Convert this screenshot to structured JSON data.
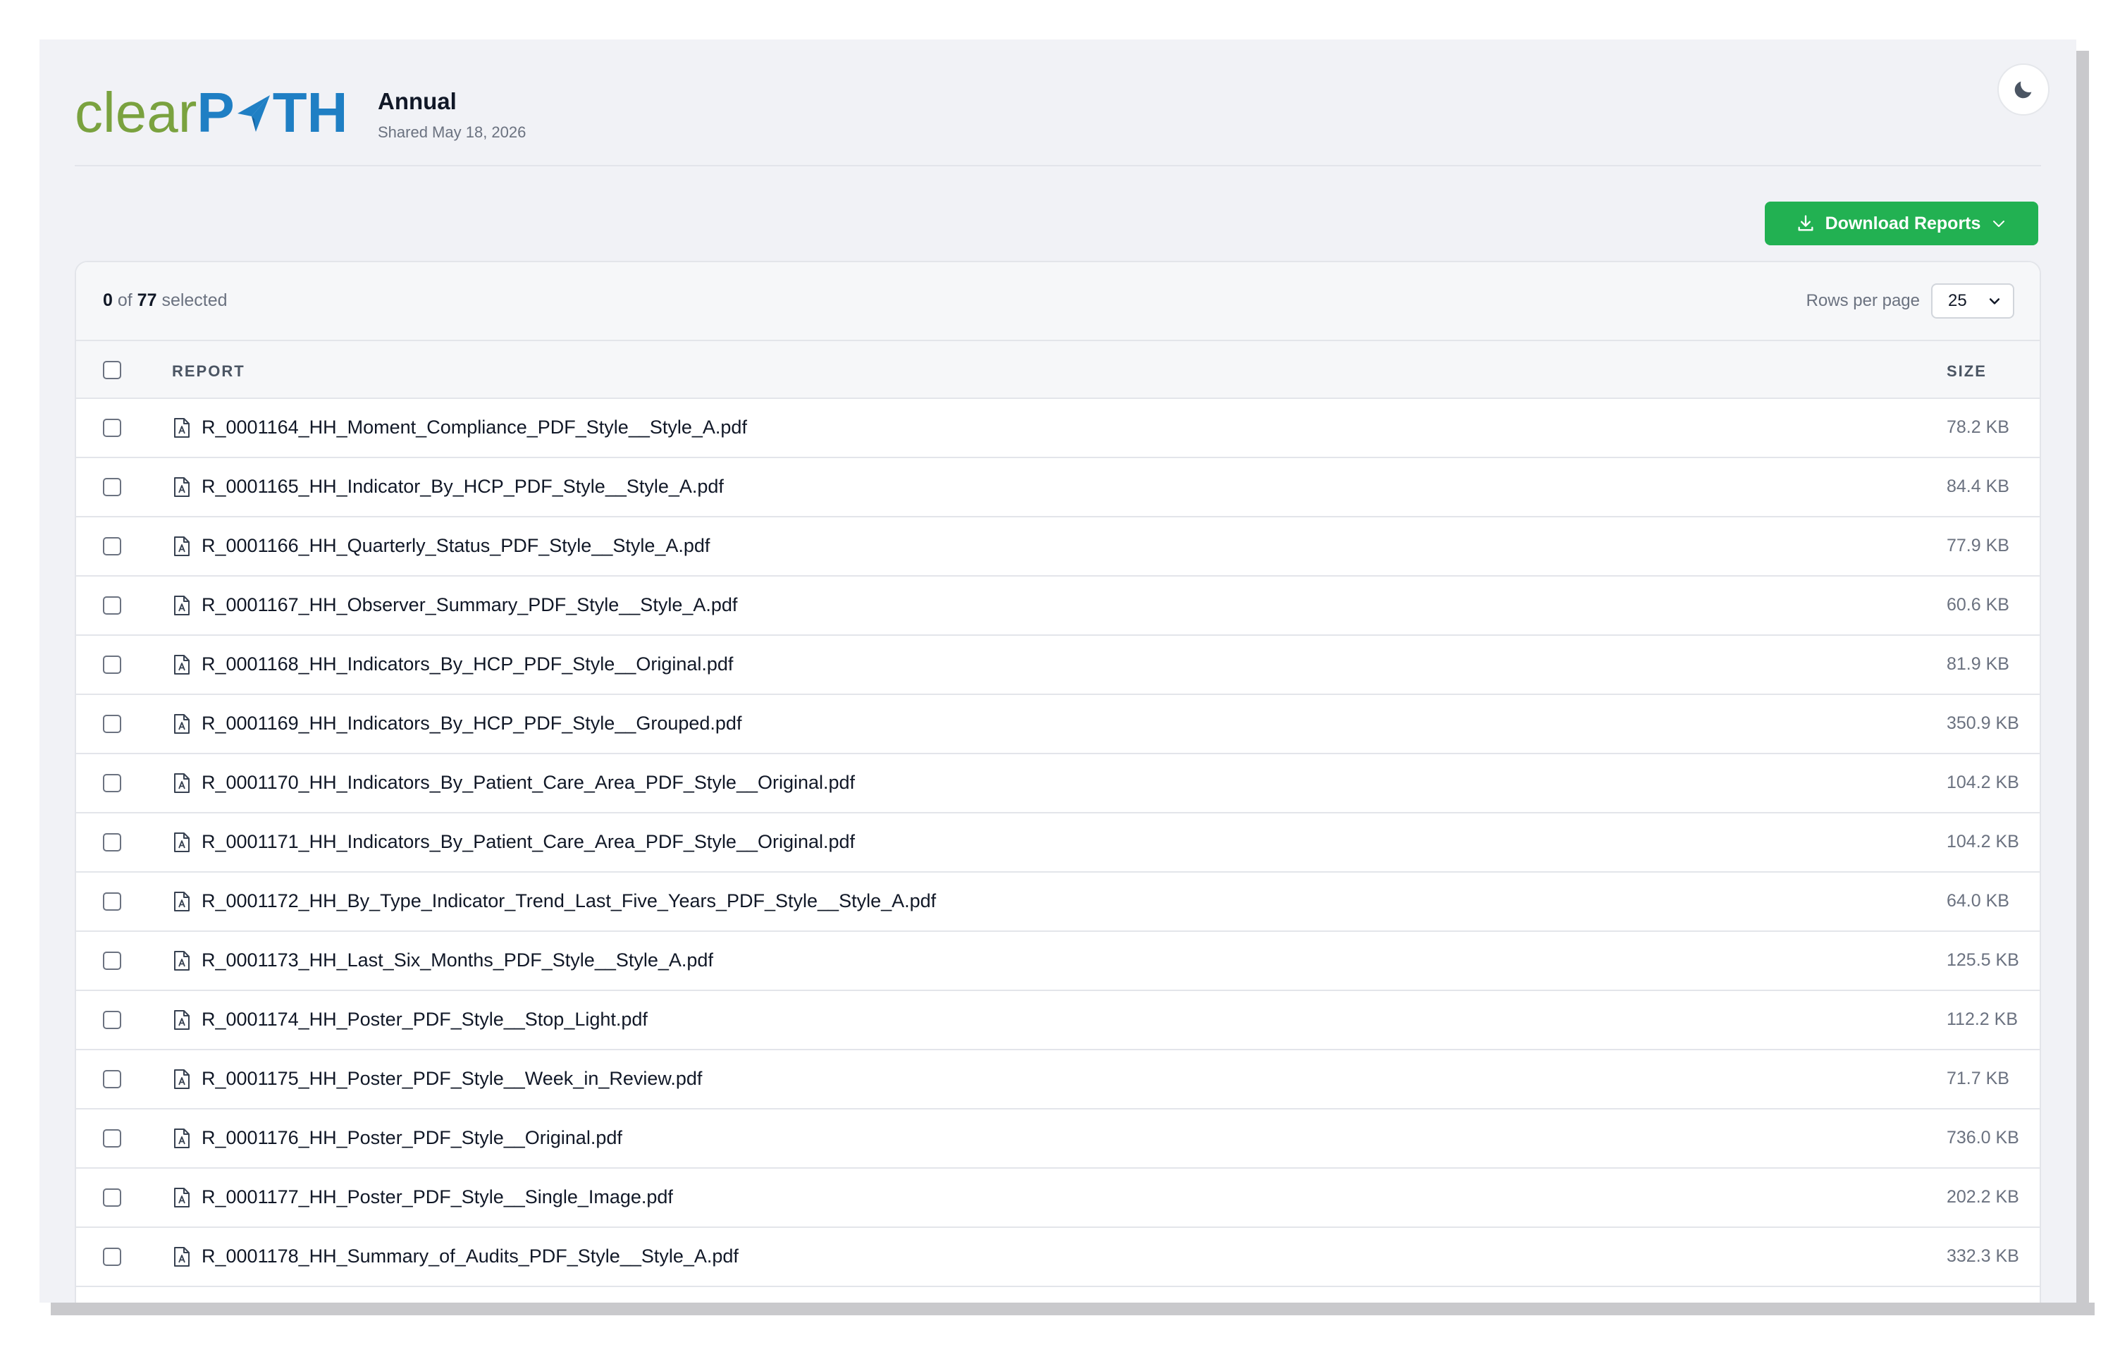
{
  "header": {
    "logo_text_left": "clear",
    "logo_text_p": "P",
    "logo_text_right": "TH",
    "title": "Annual",
    "subtitle": "Shared May 18, 2026"
  },
  "toolbar": {
    "download_label": "Download Reports",
    "selected_count": "0",
    "selected_of": "of",
    "total_count": "77",
    "selected_word": "selected",
    "rows_per_page_label": "Rows per page",
    "rows_per_page_value": "25"
  },
  "table": {
    "columns": {
      "report": "REPORT",
      "size": "SIZE"
    },
    "rows": [
      {
        "name": "R_0001164_HH_Moment_Compliance_PDF_Style__Style_A.pdf",
        "size": "78.2 KB"
      },
      {
        "name": "R_0001165_HH_Indicator_By_HCP_PDF_Style__Style_A.pdf",
        "size": "84.4 KB"
      },
      {
        "name": "R_0001166_HH_Quarterly_Status_PDF_Style__Style_A.pdf",
        "size": "77.9 KB"
      },
      {
        "name": "R_0001167_HH_Observer_Summary_PDF_Style__Style_A.pdf",
        "size": "60.6 KB"
      },
      {
        "name": "R_0001168_HH_Indicators_By_HCP_PDF_Style__Original.pdf",
        "size": "81.9 KB"
      },
      {
        "name": "R_0001169_HH_Indicators_By_HCP_PDF_Style__Grouped.pdf",
        "size": "350.9 KB"
      },
      {
        "name": "R_0001170_HH_Indicators_By_Patient_Care_Area_PDF_Style__Original.pdf",
        "size": "104.2 KB"
      },
      {
        "name": "R_0001171_HH_Indicators_By_Patient_Care_Area_PDF_Style__Original.pdf",
        "size": "104.2 KB"
      },
      {
        "name": "R_0001172_HH_By_Type_Indicator_Trend_Last_Five_Years_PDF_Style__Style_A.pdf",
        "size": "64.0 KB"
      },
      {
        "name": "R_0001173_HH_Last_Six_Months_PDF_Style__Style_A.pdf",
        "size": "125.5 KB"
      },
      {
        "name": "R_0001174_HH_Poster_PDF_Style__Stop_Light.pdf",
        "size": "112.2 KB"
      },
      {
        "name": "R_0001175_HH_Poster_PDF_Style__Week_in_Review.pdf",
        "size": "71.7 KB"
      },
      {
        "name": "R_0001176_HH_Poster_PDF_Style__Original.pdf",
        "size": "736.0 KB"
      },
      {
        "name": "R_0001177_HH_Poster_PDF_Style__Single_Image.pdf",
        "size": "202.2 KB"
      },
      {
        "name": "R_0001178_HH_Summary_of_Audits_PDF_Style__Style_A.pdf",
        "size": "332.3 KB"
      }
    ]
  },
  "icons": {
    "theme_toggle": "moon-icon",
    "download": "download-icon",
    "dropdown": "chevron-down-icon",
    "file": "pdf-file-icon"
  },
  "colors": {
    "brand_green": "#7aa23f",
    "brand_blue": "#1f7fc4",
    "accent_button": "#22b152"
  }
}
